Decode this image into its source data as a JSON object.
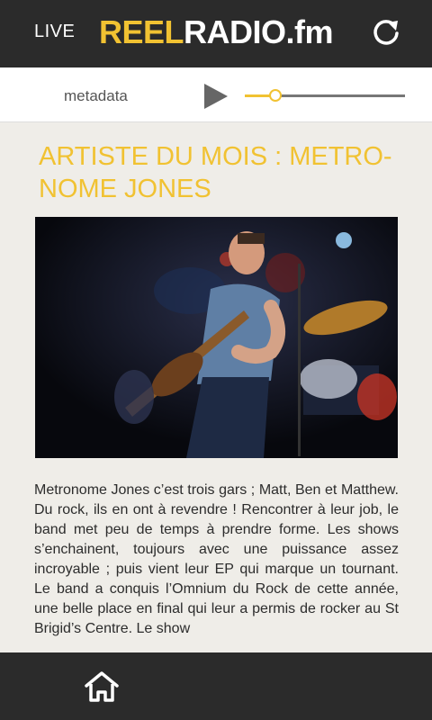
{
  "header": {
    "live_label": "LIVE",
    "logo_part1": "REEL",
    "logo_part2": "RADIO.fm",
    "refresh_icon": "refresh-icon"
  },
  "player": {
    "metadata": "metadata",
    "play_icon": "play-icon",
    "volume": 0.19
  },
  "article": {
    "title": "ARTISTE DU MOIS : METRO-NOME JONES",
    "image": "band-live-performance-photo",
    "body": "Metronome Jones c’est trois gars ; Matt, Ben et Matthew. Du rock, ils en ont à revendre ! Rencontrer à leur job, le band met peu de temps à prendre forme. Les shows s’enchainent, toujours avec une puissance assez incroyable ; puis vient leur EP qui marque un tournant. Le band a conquis l’Omnium du Rock de cette année, une belle place en final qui leur a permis de rocker au St Brigid’s Centre. Le show"
  },
  "footer": {
    "home_icon": "home-icon"
  },
  "colors": {
    "accent": "#f1c232",
    "bar": "#2b2b2b",
    "background": "#efede8"
  }
}
